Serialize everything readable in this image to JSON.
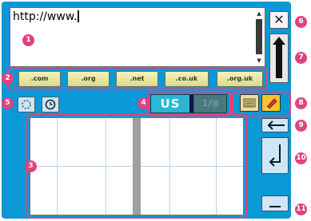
{
  "url_input": {
    "value": "http://www."
  },
  "domain_buttons": [
    ".com",
    ".org",
    ".net",
    ".co.uk",
    ".org.uk"
  ],
  "input_mode": {
    "language": "US",
    "symbols": "1/@"
  },
  "side_buttons": {
    "close": "✕",
    "backspace": "←",
    "enter": "↵",
    "space": "⎵"
  },
  "callouts": [
    "1",
    "2",
    "3",
    "4",
    "5",
    "6",
    "7",
    "8",
    "9",
    "10",
    "11"
  ],
  "colors": {
    "frame": "#0a98d6",
    "callout": "#e2417f",
    "domain_button": "#eee9a7",
    "lang_active": "#2bb6d4"
  }
}
